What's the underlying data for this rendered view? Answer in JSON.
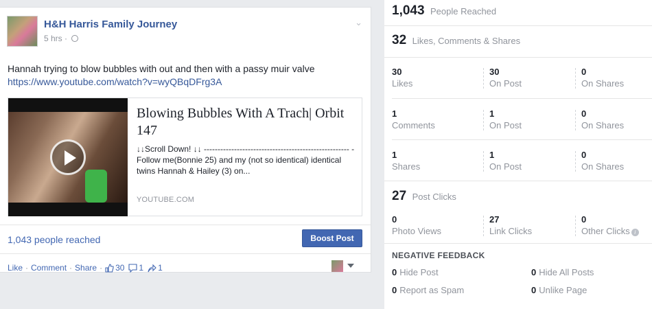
{
  "post": {
    "author": "H&H Harris Family Journey",
    "time": "5 hrs",
    "meta_sep": "·",
    "text": "Hannah trying to blow bubbles with out and then with a passy muir valve",
    "link": "https://www.youtube.com/watch?v=wyQBqDFrg3A",
    "card": {
      "title": "Blowing Bubbles With A Trach| Orbit 147",
      "description": "↓↓Scroll Down! ↓↓ ----------------------------------------------------- - Follow me(Bonnie 25) and my (not so identical) identical twins Hannah & Hailey (3) on...",
      "domain": "YOUTUBE.COM"
    },
    "reach_text": "1,043 people reached",
    "boost_label": "Boost Post",
    "actions": {
      "like": "Like",
      "comment": "Comment",
      "share": "Share",
      "sep": "·",
      "likes_count": "30",
      "comments_count": "1",
      "shares_count": "1"
    }
  },
  "insights": {
    "people_reached": {
      "value": "1,043",
      "label": "People Reached"
    },
    "engagement": {
      "value": "32",
      "label": "Likes, Comments & Shares"
    },
    "rows": [
      {
        "cells": [
          {
            "n": "30",
            "t": "Likes"
          },
          {
            "n": "30",
            "t": "On Post"
          },
          {
            "n": "0",
            "t": "On Shares"
          }
        ]
      },
      {
        "cells": [
          {
            "n": "1",
            "t": "Comments"
          },
          {
            "n": "1",
            "t": "On Post"
          },
          {
            "n": "0",
            "t": "On Shares"
          }
        ]
      },
      {
        "cells": [
          {
            "n": "1",
            "t": "Shares"
          },
          {
            "n": "1",
            "t": "On Post"
          },
          {
            "n": "0",
            "t": "On Shares"
          }
        ]
      }
    ],
    "post_clicks": {
      "value": "27",
      "label": "Post Clicks"
    },
    "clicks_row": [
      {
        "n": "0",
        "t": "Photo Views"
      },
      {
        "n": "27",
        "t": "Link Clicks"
      },
      {
        "n": "0",
        "t": "Other Clicks"
      }
    ],
    "negative_title": "NEGATIVE FEEDBACK",
    "negative": [
      {
        "n": "0",
        "t": "Hide Post"
      },
      {
        "n": "0",
        "t": "Hide All Posts"
      },
      {
        "n": "0",
        "t": "Report as Spam"
      },
      {
        "n": "0",
        "t": "Unlike Page"
      }
    ],
    "info_glyph": "i"
  },
  "icons": {
    "post_options": "chevron-down-icon",
    "privacy": "globe-icon",
    "video": "play-icon",
    "likes": "thumbs-up-icon",
    "comments": "comment-icon",
    "shares": "share-icon",
    "info": "info-icon"
  },
  "colors": {
    "link": "#365899",
    "accent": "#4267b2",
    "muted": "#90949c",
    "page_bg": "#e9ebee"
  }
}
